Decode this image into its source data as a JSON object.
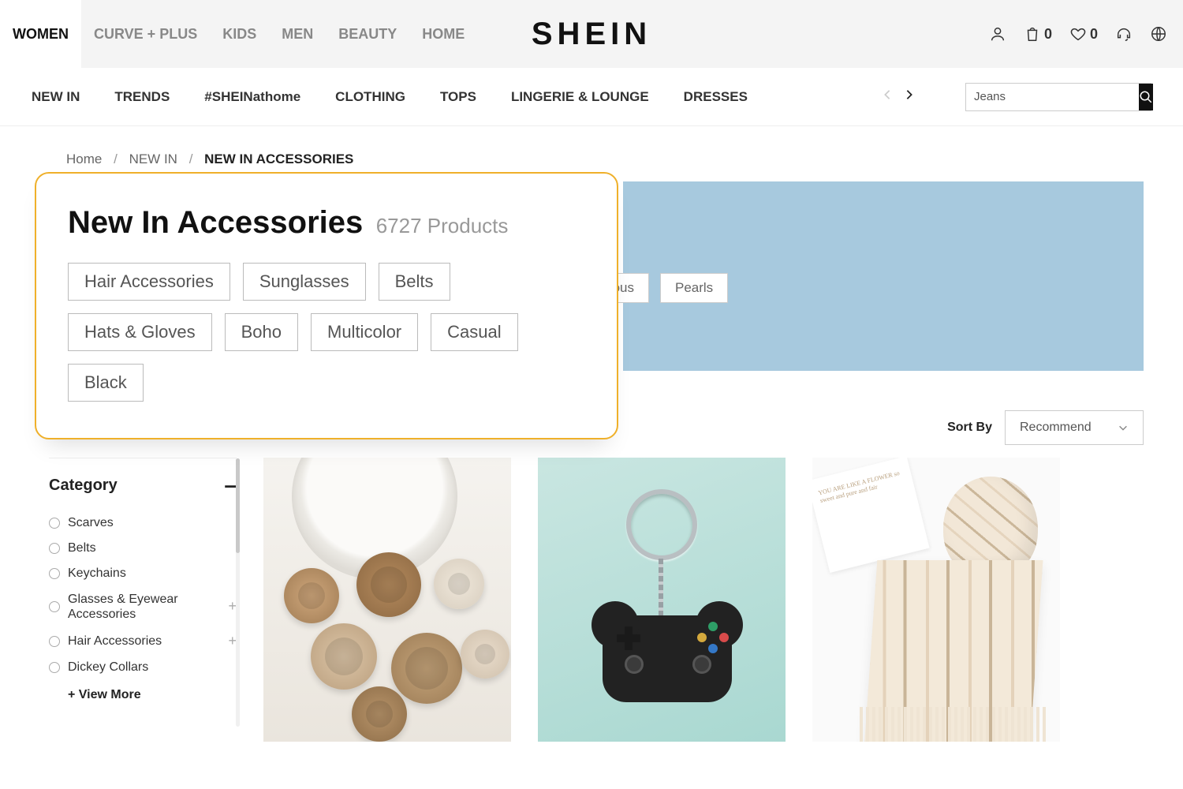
{
  "top_tabs": [
    "WOMEN",
    "CURVE + PLUS",
    "KIDS",
    "MEN",
    "BEAUTY",
    "HOME"
  ],
  "active_tab_index": 0,
  "logo": "SHEIN",
  "bag_count": "0",
  "wishlist_count": "0",
  "nav_items": [
    "NEW IN",
    "TRENDS",
    "#SHEINathome",
    "CLOTHING",
    "TOPS",
    "LINGERIE & LOUNGE",
    "DRESSES"
  ],
  "search_value": "Jeans",
  "breadcrumbs": {
    "home": "Home",
    "level1": "NEW IN",
    "current": "NEW IN ACCESSORIES"
  },
  "hero": {
    "title": "New In Accessories",
    "count": "6727 Products",
    "chips_row1": [
      "Hair Accessories",
      "Sunglasses",
      "Belts",
      "Hats & Gloves"
    ],
    "chips_row2": [
      "Boho",
      "Multicolor",
      "Casual",
      "Black"
    ]
  },
  "behind_chips": {
    "partial": "norous",
    "full": "Pearls"
  },
  "sort": {
    "label": "Sort By",
    "value": "Recommend"
  },
  "sidebar": {
    "heading": "Category",
    "items": [
      "Scarves",
      "Belts",
      "Keychains",
      "Glasses & Eyewear Accessories",
      "Hair Accessories",
      "Dickey Collars"
    ],
    "expandable": [
      false,
      false,
      false,
      true,
      true,
      false
    ],
    "view_more": "+  View More"
  },
  "paper_text": "YOU ARE LIKE A FLOWER\nso sweet and pure and fair"
}
